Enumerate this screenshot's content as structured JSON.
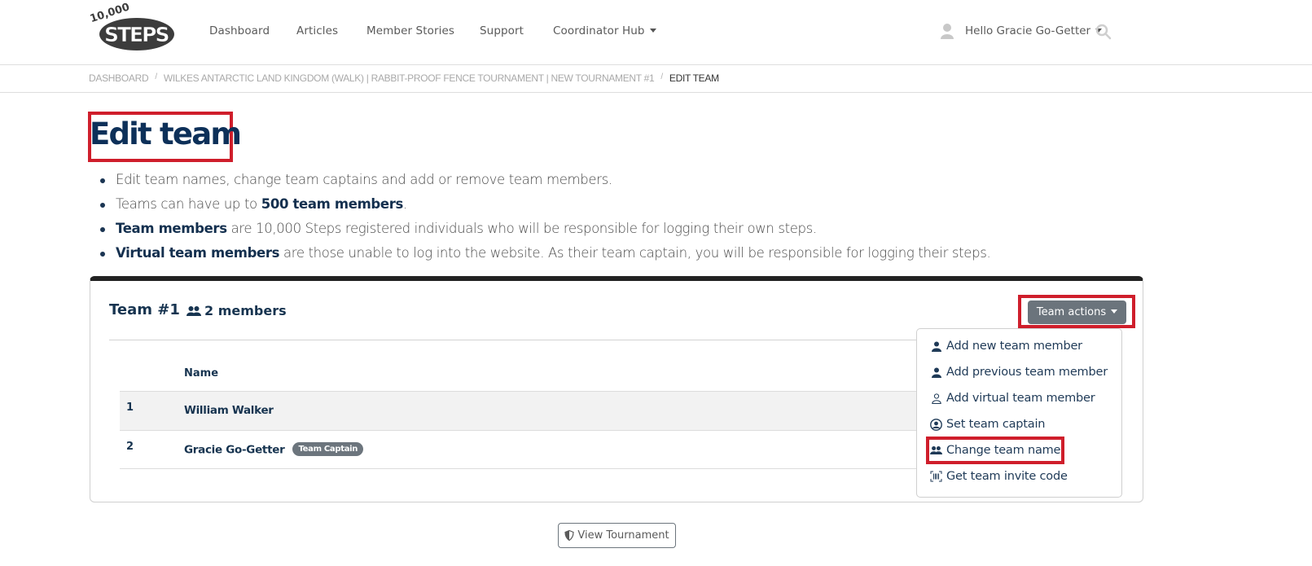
{
  "header": {
    "logo_top": "10,000",
    "logo_main": "STEPS",
    "nav": [
      {
        "label": "Dashboard"
      },
      {
        "label": "Articles"
      },
      {
        "label": "Member Stories"
      },
      {
        "label": "Support"
      },
      {
        "label": "Coordinator Hub",
        "has_dropdown": true
      }
    ],
    "user_greeting": "Hello Gracie Go-Getter",
    "icons": {
      "user": "user-icon",
      "search": "search-icon"
    }
  },
  "breadcrumb": [
    {
      "label": "DASHBOARD"
    },
    {
      "label": "WILKES ANTARCTIC LAND KINGDOM (WALK) | RABBIT-PROOF FENCE TOURNAMENT | NEW TOURNAMENT #1"
    },
    {
      "label": "EDIT TEAM",
      "active": true
    }
  ],
  "breadcrumb_separator": "/",
  "page": {
    "title": "Edit team",
    "bullets": [
      {
        "bold_prefix": "",
        "text": "Edit team names, change team captains and add or remove team members.",
        "bold_mid": "",
        "suffix": ""
      },
      {
        "bold_prefix": "",
        "text": "Teams can have up to ",
        "bold_mid": "500 team members",
        "suffix": "."
      },
      {
        "bold_prefix": "Team members",
        "text": " are 10,000 Steps registered individuals who will be responsible for logging their own steps.",
        "bold_mid": "",
        "suffix": ""
      },
      {
        "bold_prefix": "Virtual team members",
        "text": " are those unable to log into the website. As their team captain, you will be responsible for logging their steps.",
        "bold_mid": "",
        "suffix": ""
      }
    ]
  },
  "team": {
    "name": "Team #1",
    "members_label": "2 members",
    "table": {
      "headers": [
        "",
        "Name"
      ],
      "rows": [
        {
          "index": "1",
          "name": "William Walker",
          "badge": ""
        },
        {
          "index": "2",
          "name": "Gracie Go-Getter",
          "badge": "Team Captain"
        }
      ]
    },
    "actions_button": "Team actions",
    "actions_menu": [
      {
        "label": "Add new team member",
        "icon": "user-solid-icon"
      },
      {
        "label": "Add previous team member",
        "icon": "user-solid-icon"
      },
      {
        "label": "Add virtual team member",
        "icon": "user-outline-icon"
      },
      {
        "label": "Set team captain",
        "icon": "user-circle-icon"
      },
      {
        "label": "Change team name",
        "icon": "users-icon"
      },
      {
        "label": "Get team invite code",
        "icon": "barcode-icon"
      }
    ]
  },
  "footer_button": {
    "label": "View Tournament",
    "icon": "shield-icon"
  },
  "colors": {
    "primary_text": "#0d3059",
    "highlight_box": "#cf1e2b",
    "button_gray": "#6b747c"
  }
}
